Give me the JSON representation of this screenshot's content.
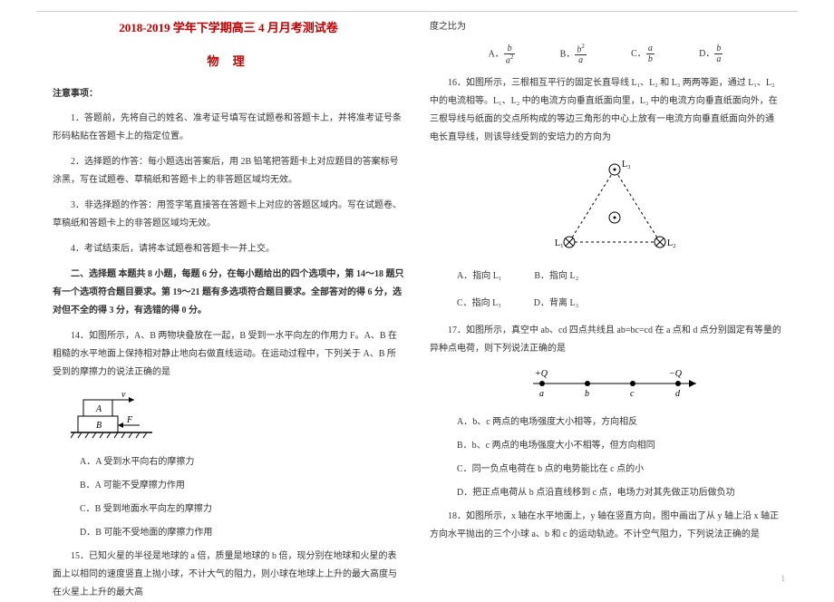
{
  "title": "2018-2019 学年下学期高三 4 月月考测试卷",
  "subject": "物 理",
  "notes_head": "注意事项：",
  "notes": [
    "1．答题前，先将自己的姓名、准考证号填写在试题卷和答题卡上，并将准考证号条形码粘贴在答题卡上的指定位置。",
    "2．选择题的作答：每小题选出答案后，用 2B 铅笔把答题卡上对应题目的答案标号涂黑，写在试题卷、草稿纸和答题卡上的非答题区域均无效。",
    "3．非选择题的作答：用签字笔直接答在答题卡上对应的答题区域内。写在试题卷、草稿纸和答题卡上的非答题区域均无效。",
    "4．考试结束后，请将本试题卷和答题卡一并上交。"
  ],
  "section2_head": "二、选择题  本题共 8 小题，每题 6 分，在每小题给出的四个选项中，第 14～18 题只有一个选项符合题目要求。第 19～21 题有多选项符合题目要求。全部答对的得 6 分，选对但不全的得 3 分，有选错的得 0 分。",
  "q14_text": "14．如图所示，A、B 两物块叠放在一起，B 受到一水平向左的作用力 F。A、B 在粗糙的水平地面上保持相对静止地向右做直线运动。在运动过程中，下列关于 A、B 所受到的摩擦力的说法正确的是",
  "q14_A": "A．A 受到水平向右的摩擦力",
  "q14_B": "B．A 可能不受摩擦力作用",
  "q14_C": "C．B 受到地面水平向左的摩擦力",
  "q14_D": "D．B 可能不受地面的摩擦力作用",
  "q15_text": "15．已知火星的半径是地球的 a 倍，质量是地球的 b 倍，现分别在地球和火星的表面上以相同的速度竖直上抛小球，不计大气的阻力，则小球在地球上上升的最大高度与在火星上上升的最大高",
  "q15_cont": "度之比为",
  "q15_A": "A．",
  "q15_B": "B．",
  "q15_C": "C．",
  "q15_D": "D．",
  "q16_text": "16．如图所示，三根相互平行的固定长直导线 L₁、L₂ 和 L₃ 两两等距，通过 L₁、L₂ 中的电流相等。L₁、L₂ 中的电流方向垂直纸面向里，L₃ 中的电流方向垂直纸面向外，在三根导线与纸面的交点所构成的等边三角形的中心上放有一电流方向垂直纸面向外的通电长直导线，则该导线受到的安培力的方向为",
  "q16_A": "A．指向 L₁",
  "q16_B": "B．指向 L₂",
  "q16_C": "C．指向 L₃",
  "q16_D": "D．背离 L₃",
  "q17_text": "17．如图所示，真空中 ab、cd 四点共线且 ab=bc=cd 在 a 点和 d 点分别固定有等量的异种点电荷，则下列说法正确的是",
  "q17_A": "A．b、c 两点的电场强度大小相等，方向相反",
  "q17_B": "B．b、c 两点的电场强度大小不相等，但方向相同",
  "q17_C": "C．同一负点电荷在 b 点的电势能比在 c 点的小",
  "q17_D": "D．把正点电荷从 b 点沿直线移到 c 点，电场力对其先做正功后做负功",
  "q18_text": "18．如图所示，x 轴在水平地面上，y 轴在竖直方向，图中画出了从 y 轴上沿 x 轴正方向水平抛出的三个小球 a、b 和 c 的运动轨迹。不计空气阻力，下列说法正确的是",
  "page_num": "1",
  "fig14": {
    "A": "A",
    "B": "B",
    "F": "F",
    "v": "v"
  },
  "fig16": {
    "L1": "L₁",
    "L2": "L₂",
    "L3": "L₃"
  },
  "fig17": {
    "plusQ": "+Q",
    "minusQ": "−Q",
    "a": "a",
    "b": "b",
    "c": "c",
    "d": "d"
  }
}
